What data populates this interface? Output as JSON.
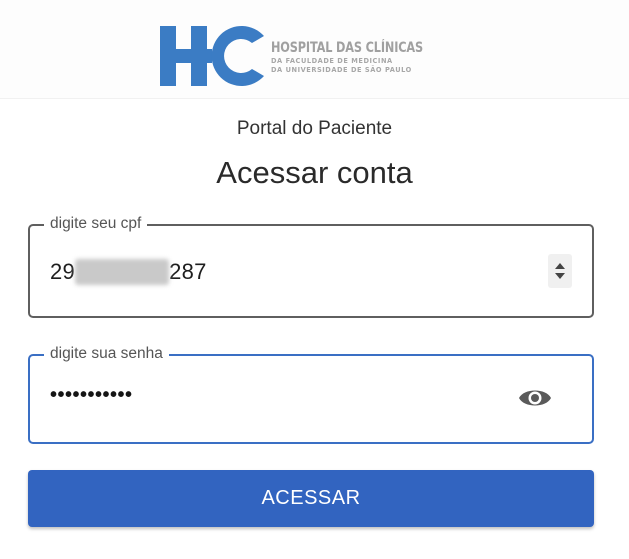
{
  "brand": {
    "line1": "HOSPITAL DAS CLÍNICAS",
    "line2": "DA FACULDADE DE MEDICINA",
    "line3": "DA UNIVERSIDADE DE SÃO PAULO",
    "colors": {
      "primary_blue": "#3b7cc4",
      "text_gray": "#a0a0a0"
    }
  },
  "page": {
    "subtitle": "Portal do Paciente",
    "title": "Acessar conta"
  },
  "cpf_field": {
    "label": "digite seu cpf",
    "value_start": "29",
    "value_end": "287",
    "masked": true,
    "control_icon": "number-spinner-icon"
  },
  "password_field": {
    "label": "digite sua senha",
    "value_display": "•••••••••••",
    "toggle_icon": "eye-icon",
    "border_color": "#3a6fc4"
  },
  "submit": {
    "label": "ACESSAR",
    "color": "#3264c0"
  }
}
